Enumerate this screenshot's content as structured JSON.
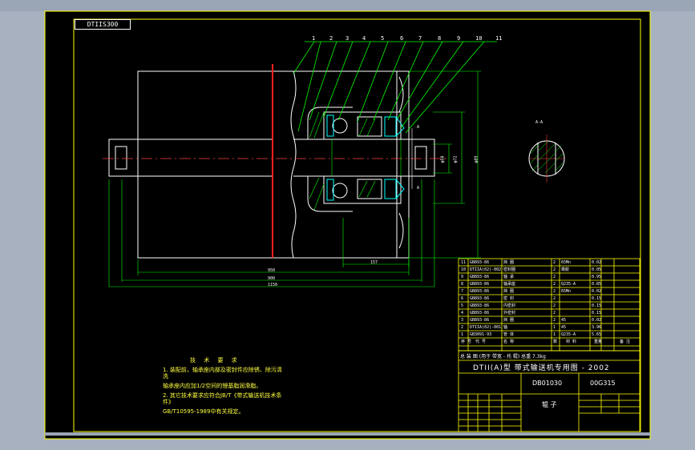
{
  "drawing": {
    "drawing_number_box": "DTIIS300",
    "leader_numbers": [
      "1",
      "2",
      "3",
      "4",
      "5",
      "6",
      "7",
      "8",
      "9",
      "10",
      "11"
    ],
    "section_label": "A-A",
    "section_marks": [
      "A",
      "A"
    ],
    "dims": {
      "bottom": [
        "950",
        "900",
        "1150"
      ],
      "inner_bottom": "157",
      "right": [
        "φ50",
        "φ72",
        "φ89"
      ],
      "right2": "φ89"
    }
  },
  "tech_notes": {
    "title": "技 术 要 求",
    "lines": [
      "1. 装配前，轴承座内部及密封件应除锈、除污清",
      "洗",
      "  轴承座内应加1/2空间的锂基脂润滑脂。",
      "2. 其它技术要求应符合JB/T《带式输送机技术条",
      "件》",
      "   GB/T10595-1989中有关规定。"
    ]
  },
  "parts_list": {
    "rows": [
      {
        "no": "11",
        "code": "GB893-86",
        "name": "挡 圈",
        "qty": "2",
        "mat": "65Mn",
        "weight": "0.02"
      },
      {
        "no": "10",
        "code": "DTIIA(02)-002",
        "name": "密封圈",
        "qty": "2",
        "mat": "橡胶",
        "weight": "0.05"
      },
      {
        "no": "9",
        "code": "GB893-86",
        "name": "轴 承",
        "qty": "2",
        "mat": "",
        "weight": "0.95"
      },
      {
        "no": "8",
        "code": "GB893-86",
        "name": "轴承座",
        "qty": "2",
        "mat": "Q235-A",
        "weight": "0.85"
      },
      {
        "no": "7",
        "code": "GB893-86",
        "name": "挡 圈",
        "qty": "2",
        "mat": "65Mn",
        "weight": "0.02"
      },
      {
        "no": "6",
        "code": "GB893-86",
        "name": "密 封",
        "qty": "2",
        "mat": "",
        "weight": "0.15"
      },
      {
        "no": "5",
        "code": "GB893-86",
        "name": "内密封",
        "qty": "2",
        "mat": "",
        "weight": "0.15"
      },
      {
        "no": "4",
        "code": "GB893-86",
        "name": "外密封",
        "qty": "2",
        "mat": "",
        "weight": "0.15"
      },
      {
        "no": "3",
        "code": "GB893-86",
        "name": "挡 圈",
        "qty": "2",
        "mat": "45",
        "weight": "0.02"
      },
      {
        "no": "2",
        "code": "DTIIA(02)-001",
        "name": "轴",
        "qty": "1",
        "mat": "45",
        "weight": "3.96"
      },
      {
        "no": "1",
        "code": "GB3091-93",
        "name": "管 体",
        "qty": "1",
        "mat": "Q235-A",
        "weight": "5.65"
      }
    ],
    "header": {
      "no": "序 号",
      "code": "代 号",
      "name": "名 称",
      "qty": "数",
      "mat": "材 料",
      "weight": "重量",
      "remark": "备 注"
    },
    "summary": "总 装 图    (用于 带宽 - 托 辊) 总重 7.3kg"
  },
  "title_block": {
    "title": "DTII(A)型 带式输送机专用图 - 2002",
    "drawing_no": "DB01030",
    "code": "00G315",
    "part_name": "辊 子"
  },
  "colors": {
    "frame": "#ffff00",
    "geometry": "#ffffff",
    "dims": "#00ff00",
    "centerline": "#ff2020",
    "cut_line": "#ff0000",
    "seals": "#00ffff"
  }
}
